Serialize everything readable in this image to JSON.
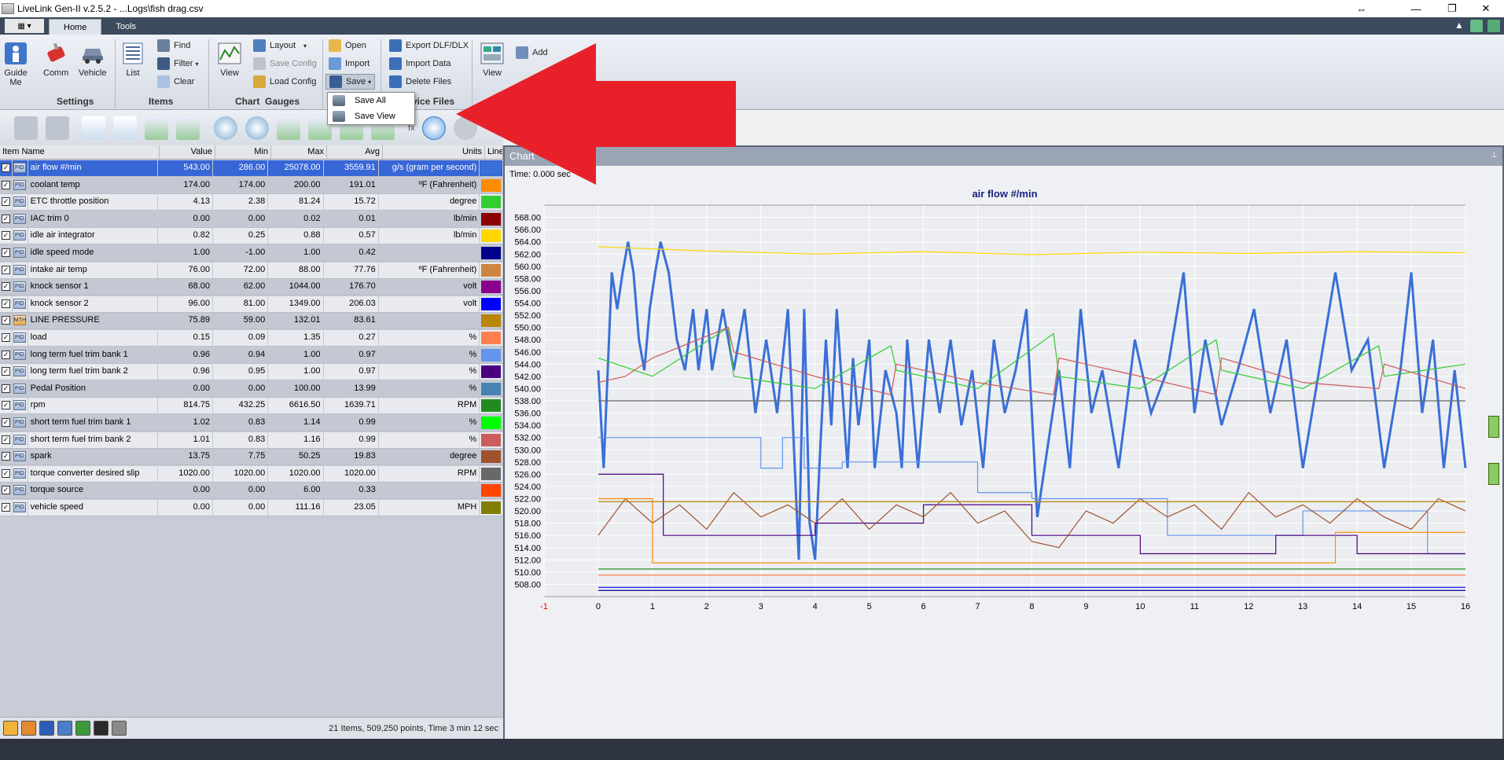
{
  "window": {
    "title": "LiveLink Gen-II  v.2.5.2 - ...Logs\\fish drag.csv"
  },
  "tabs": [
    {
      "label": "Home"
    },
    {
      "label": "Tools"
    }
  ],
  "ribbon": {
    "guide_me": "Guide\nMe",
    "comm": "Comm",
    "vehicle": "Vehicle",
    "list": "List",
    "find": "Find",
    "filter": "Filter",
    "clear": "Clear",
    "view": "View",
    "layout": "Layout",
    "save_config": "Save Config",
    "load_config": "Load Config",
    "open": "Open",
    "import": "Import",
    "save": "Save",
    "export": "Export DLF/DLX",
    "import_data": "Import Data",
    "delete_files": "Delete Files",
    "view2": "View",
    "add": "Add",
    "groups": {
      "settings": "Settings",
      "items": "Items",
      "chart": "Chart",
      "gauges": "Gauges",
      "device_files": "vice Files"
    }
  },
  "save_menu": [
    "Save All",
    "Save View"
  ],
  "toolbar": {
    "fx": "fx"
  },
  "table": {
    "headers": [
      "Item Name",
      "Value",
      "Min",
      "Max",
      "Avg",
      "Units",
      "Line"
    ],
    "rows": [
      {
        "name": "air flow #/min",
        "value": "543.00",
        "min": "286.00",
        "max": "25078.00",
        "avg": "3559.91",
        "units": "g/s (gram per second)",
        "color": "#3a6fd8",
        "pid": "PID"
      },
      {
        "name": "coolant temp",
        "value": "174.00",
        "min": "174.00",
        "max": "200.00",
        "avg": "191.01",
        "units": "ºF (Fahrenheit)",
        "color": "#ff8c00",
        "pid": "PID"
      },
      {
        "name": "ETC throttle position",
        "value": "4.13",
        "min": "2.38",
        "max": "81.24",
        "avg": "15.72",
        "units": "degree",
        "color": "#32cd32",
        "pid": "PID"
      },
      {
        "name": "IAC trim 0",
        "value": "0.00",
        "min": "0.00",
        "max": "0.02",
        "avg": "0.01",
        "units": "lb/min",
        "color": "#8b0000",
        "pid": "PID"
      },
      {
        "name": "idle air integrator",
        "value": "0.82",
        "min": "0.25",
        "max": "0.88",
        "avg": "0.57",
        "units": "lb/min",
        "color": "#ffd700",
        "pid": "PID"
      },
      {
        "name": "idle speed mode",
        "value": "1.00",
        "min": "-1.00",
        "max": "1.00",
        "avg": "0.42",
        "units": "",
        "color": "#00008b",
        "pid": "PID"
      },
      {
        "name": "intake air temp",
        "value": "76.00",
        "min": "72.00",
        "max": "88.00",
        "avg": "77.76",
        "units": "ºF (Fahrenheit)",
        "color": "#cd853f",
        "pid": "PID"
      },
      {
        "name": "knock sensor 1",
        "value": "68.00",
        "min": "62.00",
        "max": "1044.00",
        "avg": "176.70",
        "units": "volt",
        "color": "#8b008b",
        "pid": "PID"
      },
      {
        "name": "knock sensor 2",
        "value": "96.00",
        "min": "81.00",
        "max": "1349.00",
        "avg": "206.03",
        "units": "volt",
        "color": "#0000ff",
        "pid": "PID"
      },
      {
        "name": "LINE PRESSURE",
        "value": "75.89",
        "min": "59.00",
        "max": "132.01",
        "avg": "83.61",
        "units": "",
        "color": "#b8860b",
        "pid": "MTH"
      },
      {
        "name": "load",
        "value": "0.15",
        "min": "0.09",
        "max": "1.35",
        "avg": "0.27",
        "units": "%",
        "color": "#ff7f50",
        "pid": "PID"
      },
      {
        "name": "long term fuel trim bank 1",
        "value": "0.96",
        "min": "0.94",
        "max": "1.00",
        "avg": "0.97",
        "units": "%",
        "color": "#6495ed",
        "pid": "PID"
      },
      {
        "name": "long term fuel trim bank 2",
        "value": "0.96",
        "min": "0.95",
        "max": "1.00",
        "avg": "0.97",
        "units": "%",
        "color": "#4b0082",
        "pid": "PID"
      },
      {
        "name": "Pedal Position",
        "value": "0.00",
        "min": "0.00",
        "max": "100.00",
        "avg": "13.99",
        "units": "%",
        "color": "#4682b4",
        "pid": "PID"
      },
      {
        "name": "rpm",
        "value": "814.75",
        "min": "432.25",
        "max": "6616.50",
        "avg": "1639.71",
        "units": "RPM",
        "color": "#228b22",
        "pid": "PID"
      },
      {
        "name": "short term fuel trim bank 1",
        "value": "1.02",
        "min": "0.83",
        "max": "1.14",
        "avg": "0.99",
        "units": "%",
        "color": "#00ff00",
        "pid": "PID"
      },
      {
        "name": "short term fuel trim bank 2",
        "value": "1.01",
        "min": "0.83",
        "max": "1.16",
        "avg": "0.99",
        "units": "%",
        "color": "#cd5c5c",
        "pid": "PID"
      },
      {
        "name": "spark",
        "value": "13.75",
        "min": "7.75",
        "max": "50.25",
        "avg": "19.83",
        "units": "degree",
        "color": "#a0522d",
        "pid": "PID"
      },
      {
        "name": "torque converter desired slip",
        "value": "1020.00",
        "min": "1020.00",
        "max": "1020.00",
        "avg": "1020.00",
        "units": "RPM",
        "color": "#696969",
        "pid": "PID"
      },
      {
        "name": "torque source",
        "value": "0.00",
        "min": "0.00",
        "max": "6.00",
        "avg": "0.33",
        "units": "",
        "color": "#ff4500",
        "pid": "PID"
      },
      {
        "name": "vehicle speed",
        "value": "0.00",
        "min": "0.00",
        "max": "111.16",
        "avg": "23.05",
        "units": "MPH",
        "color": "#808000",
        "pid": "PID"
      }
    ]
  },
  "status": {
    "text": "21 Items, 509,250 points, Time 3 min 12 sec"
  },
  "chart_panel": {
    "header": "Chart",
    "time_label": "Time: 0.000 sec"
  },
  "chart_data": {
    "type": "line",
    "title": "air flow #/min",
    "xlabel": "",
    "ylabel": "",
    "xlim": [
      -1,
      16
    ],
    "ylim": [
      506,
      570
    ],
    "xticks": [
      -1,
      0,
      1,
      2,
      3,
      4,
      5,
      6,
      7,
      8,
      9,
      10,
      11,
      12,
      13,
      14,
      15,
      16
    ],
    "yticks": [
      508,
      510,
      512,
      514,
      516,
      518,
      520,
      522,
      524,
      526,
      528,
      530,
      532,
      534,
      536,
      538,
      540,
      542,
      544,
      546,
      548,
      550,
      552,
      554,
      556,
      558,
      560,
      562,
      564,
      566,
      568
    ],
    "grid": true,
    "series": [
      {
        "color": "#3a6fd8",
        "x": [
          0,
          0.1,
          0.25,
          0.35,
          0.45,
          0.55,
          0.65,
          0.75,
          0.85,
          0.95,
          1.05,
          1.15,
          1.3,
          1.45,
          1.6,
          1.75,
          1.85,
          2.0,
          2.1,
          2.3,
          2.5,
          2.7,
          2.9,
          3.1,
          3.3,
          3.5,
          3.7,
          3.8,
          3.9,
          4.0,
          4.1,
          4.2,
          4.3,
          4.4,
          4.6,
          4.7,
          4.8,
          5.0,
          5.1,
          5.3,
          5.5,
          5.6,
          5.7,
          5.9,
          6.1,
          6.3,
          6.5,
          6.7,
          6.9,
          7.1,
          7.3,
          7.5,
          7.7,
          7.9,
          8.1,
          8.3,
          8.5,
          8.7,
          8.9,
          9.1,
          9.3,
          9.6,
          9.9,
          10.2,
          10.5,
          10.8,
          11.0,
          11.2,
          11.5,
          11.8,
          12.1,
          12.4,
          12.7,
          13.0,
          13.3,
          13.6,
          13.9,
          14.2,
          14.5,
          14.8,
          15.0,
          15.2,
          15.4,
          15.6,
          15.8,
          16.0
        ],
        "y": [
          543,
          527,
          559,
          553,
          559,
          564,
          559,
          548,
          543,
          553,
          559,
          564,
          559,
          548,
          543,
          553,
          543,
          553,
          543,
          553,
          543,
          553,
          536,
          548,
          536,
          553,
          512,
          553,
          518,
          512,
          531,
          548,
          534,
          553,
          527,
          545,
          534,
          548,
          527,
          543,
          536,
          527,
          548,
          527,
          548,
          536,
          548,
          534,
          543,
          527,
          548,
          536,
          543,
          553,
          519,
          531,
          543,
          527,
          553,
          536,
          543,
          527,
          548,
          536,
          543,
          559,
          536,
          548,
          534,
          543,
          553,
          536,
          548,
          527,
          543,
          559,
          543,
          548,
          527,
          543,
          559,
          536,
          548,
          527,
          543,
          527
        ]
      },
      {
        "color": "#ffd700",
        "x": [
          0,
          2,
          4,
          6,
          8,
          10,
          12,
          14,
          16
        ],
        "y": [
          563.2,
          562.5,
          562.0,
          562.4,
          561.9,
          562.3,
          562.1,
          562.4,
          562.2
        ]
      },
      {
        "color": "#32cd32",
        "x": [
          0,
          1,
          2.4,
          2.5,
          4.0,
          5.4,
          5.5,
          7.0,
          8.4,
          8.5,
          10.0,
          11.4,
          11.5,
          13.0,
          14.4,
          14.5,
          16.0
        ],
        "y": [
          545,
          542,
          550,
          542,
          540,
          547,
          543,
          540,
          549,
          542,
          540,
          548,
          543,
          540,
          547,
          542,
          544
        ]
      },
      {
        "color": "#cd5c5c",
        "x": [
          0,
          0.5,
          1,
          2.4,
          2.5,
          4.0,
          5.4,
          5.5,
          7.0,
          8.4,
          8.5,
          10.0,
          11.4,
          11.5,
          13.0,
          14.4,
          14.5,
          16.0
        ],
        "y": [
          541,
          542,
          545,
          550,
          546,
          542,
          539,
          544,
          541,
          539,
          545,
          542,
          539,
          545,
          541,
          540,
          544,
          540
        ]
      },
      {
        "color": "#696969",
        "x": [
          0,
          16
        ],
        "y": [
          538,
          538
        ]
      },
      {
        "color": "#6495ed",
        "x": [
          0,
          3.0,
          3.0,
          3.4,
          3.4,
          3.8,
          3.8,
          4.5,
          4.5,
          7.0,
          7.0,
          8.0,
          8.0,
          10.5,
          10.5,
          13.0,
          13.0,
          15.3,
          15.3,
          16
        ],
        "y": [
          532,
          532,
          527,
          527,
          532,
          532,
          527,
          527,
          528,
          528,
          523,
          523,
          522,
          522,
          516,
          516,
          520,
          520,
          513,
          513
        ]
      },
      {
        "color": "#4b0082",
        "x": [
          0,
          1.2,
          1.2,
          4.0,
          4.0,
          6.0,
          6.0,
          8.0,
          8.0,
          10.0,
          10.0,
          12.5,
          12.5,
          14.0,
          14.0,
          16
        ],
        "y": [
          526,
          526,
          516,
          516,
          518,
          518,
          521,
          521,
          516,
          516,
          513,
          513,
          516,
          516,
          513,
          513
        ]
      },
      {
        "color": "#a0522d",
        "x": [
          0,
          0.5,
          1.0,
          1.5,
          2.0,
          2.5,
          3.0,
          3.5,
          4.0,
          4.5,
          5.0,
          5.5,
          6.0,
          6.5,
          7.0,
          7.5,
          8.0,
          8.5,
          9.0,
          9.5,
          10.0,
          10.5,
          11.0,
          11.5,
          12.0,
          12.5,
          13.0,
          13.5,
          14.0,
          14.5,
          15.0,
          15.5,
          16.0
        ],
        "y": [
          516,
          522,
          518,
          521,
          517,
          523,
          519,
          521,
          518,
          522,
          517,
          521,
          519,
          523,
          518,
          520,
          515,
          514,
          520,
          518,
          522,
          519,
          521,
          517,
          523,
          519,
          521,
          518,
          522,
          519,
          517,
          522,
          520
        ]
      },
      {
        "color": "#ff8c00",
        "x": [
          0,
          1,
          1,
          13.6,
          13.6,
          16
        ],
        "y": [
          522,
          522,
          511.5,
          511.5,
          516.5,
          516.5
        ]
      },
      {
        "color": "#b8860b",
        "x": [
          0,
          16
        ],
        "y": [
          521.5,
          521.5
        ]
      },
      {
        "color": "#228b22",
        "x": [
          0,
          16
        ],
        "y": [
          510.5,
          510.5
        ]
      },
      {
        "color": "#ff7f50",
        "x": [
          0,
          16
        ],
        "y": [
          509.5,
          509.5
        ]
      },
      {
        "color": "#0000ff",
        "x": [
          0,
          16
        ],
        "y": [
          507.5,
          507.5
        ]
      },
      {
        "color": "#00008b",
        "x": [
          0,
          16
        ],
        "y": [
          507,
          507
        ]
      }
    ]
  }
}
